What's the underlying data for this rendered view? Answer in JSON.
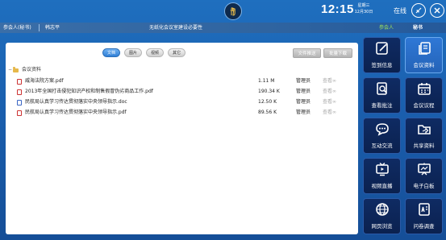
{
  "header": {
    "time": "12:15",
    "weekday": "星期三",
    "date": "12月30日",
    "status": "在线"
  },
  "infobar": {
    "role": "参会人(秘书)",
    "name": "韩志平",
    "notice": "无纸化会议室建设必要性",
    "tab_participant": "参会人",
    "tab_secretary": "秘书"
  },
  "filters": [
    "文档",
    "图片",
    "视频",
    "其它"
  ],
  "actions": {
    "upload": "文件推送",
    "batch_download": "批量下载"
  },
  "tree": {
    "root": "会议资料",
    "files": [
      {
        "name": "威海法院方案.pdf",
        "type": "pdf",
        "size": "1.11 M",
        "owner": "管理员",
        "view": "查看∞"
      },
      {
        "name": "2013年全国打击侵犯知识产权和制售假冒伪劣商品工作.pdf",
        "type": "pdf",
        "size": "190.34 K",
        "owner": "管理员",
        "view": "查看∞"
      },
      {
        "name": "民航局认真学习传达贯彻落实中央领导指示.doc",
        "type": "doc",
        "size": "12.50 K",
        "owner": "管理员",
        "view": "查看∞"
      },
      {
        "name": "民航局认真学习传达贯彻落实中央领导指示.pdf",
        "type": "pdf",
        "size": "89.56 K",
        "owner": "管理员",
        "view": "查看∞"
      }
    ]
  },
  "menu": [
    {
      "label": "签到信息",
      "icon": "sign-in-icon"
    },
    {
      "label": "会议资料",
      "icon": "documents-icon"
    },
    {
      "label": "查看批注",
      "icon": "annotation-icon"
    },
    {
      "label": "会议议程",
      "icon": "calendar-icon"
    },
    {
      "label": "互动交流",
      "icon": "chat-icon"
    },
    {
      "label": "共享资料",
      "icon": "shared-folder-icon"
    },
    {
      "label": "视频直播",
      "icon": "tv-icon"
    },
    {
      "label": "电子白板",
      "icon": "whiteboard-icon"
    },
    {
      "label": "网页浏览",
      "icon": "globe-icon"
    },
    {
      "label": "问卷调查",
      "icon": "survey-icon"
    }
  ],
  "colors": {
    "accent": "#2f78d6",
    "tile": "#0f2b63",
    "highlight": "#9fe35b"
  }
}
